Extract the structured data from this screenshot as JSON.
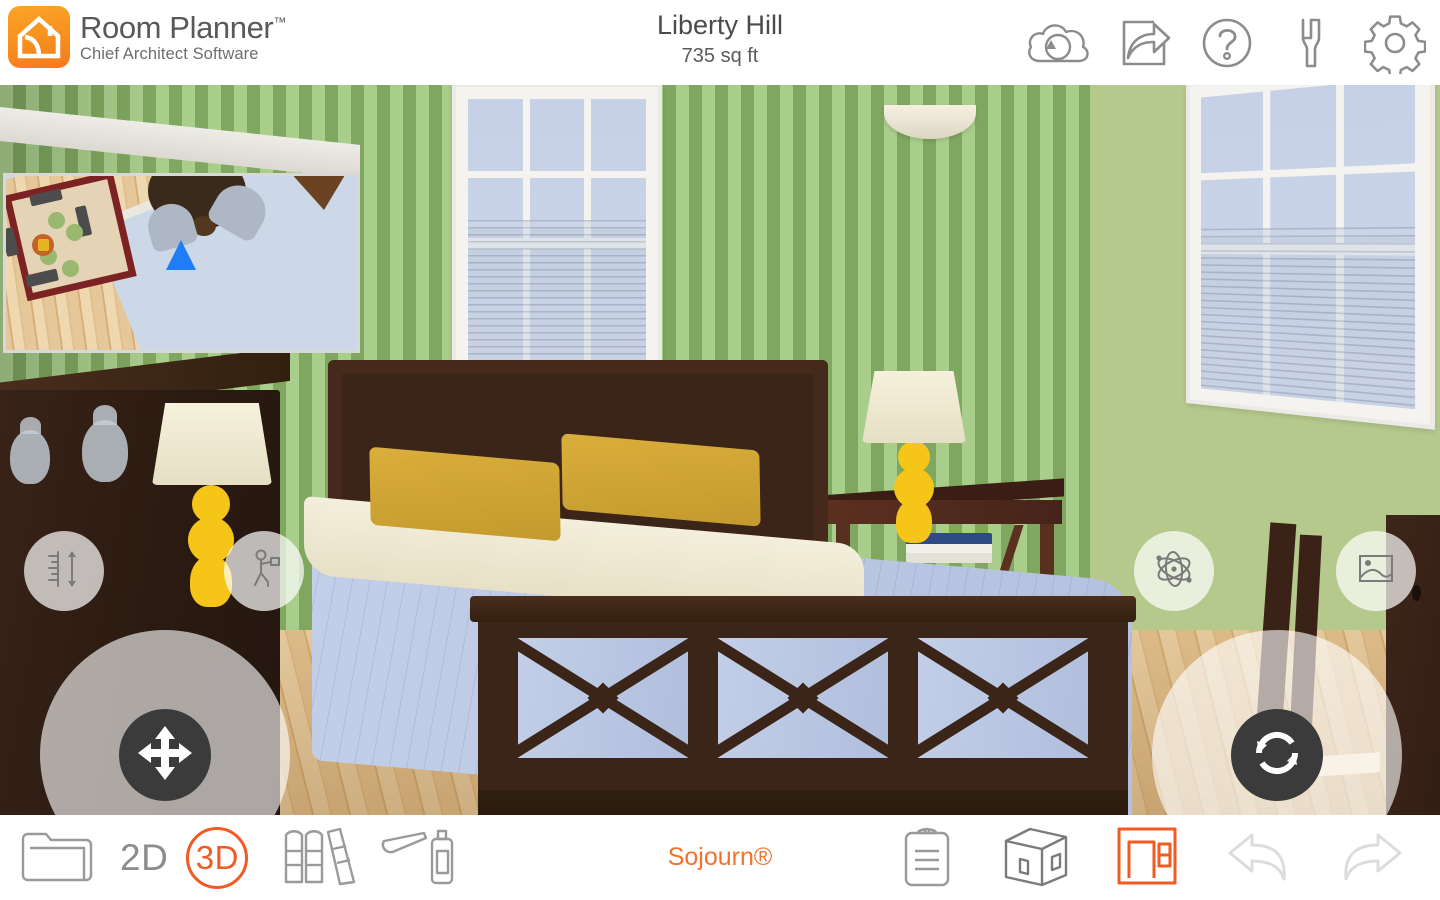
{
  "header": {
    "brand_name": "Room Planner",
    "brand_tm": "™",
    "brand_sub": "Chief Architect Software",
    "project_title": "Liberty Hill",
    "project_area": "735 sq ft",
    "actions": [
      {
        "name": "cloud-sync-icon",
        "label": "Cloud Sync"
      },
      {
        "name": "share-icon",
        "label": "Share"
      },
      {
        "name": "help-icon",
        "label": "Help"
      },
      {
        "name": "tools-icon",
        "label": "Tools"
      },
      {
        "name": "settings-icon",
        "label": "Settings"
      }
    ]
  },
  "viewport": {
    "mode": "3D",
    "minimap": {
      "label": "Floor plan overview",
      "camera_marker": "camera-position-arrow"
    },
    "controls": {
      "elevation": {
        "label": "Elevation / Height",
        "icon": "ruler-height-icon"
      },
      "walk": {
        "label": "Walkthrough",
        "icon": "walking-person-icon"
      },
      "orbit": {
        "label": "Orbit",
        "icon": "atom-orbit-icon"
      },
      "photo": {
        "label": "Render Photo",
        "icon": "photo-image-icon"
      },
      "pan_joystick": {
        "label": "Pan",
        "icon": "four-way-arrows-icon"
      },
      "rotate_joystick": {
        "label": "Rotate",
        "icon": "circular-arrows-icon"
      }
    }
  },
  "toolbar": {
    "folder_label": "Projects",
    "view_2d": "2D",
    "view_3d": "3D",
    "library_label": "Library",
    "materials_label": "Materials",
    "style_name": "Sojourn®",
    "notes_label": "Notes",
    "building_label": "Building",
    "room_plan_label": "Room Plan",
    "undo_label": "Undo",
    "redo_label": "Redo"
  },
  "colors": {
    "accent_orange": "#f15a22",
    "style_orange": "#f3722c",
    "logo_orange": "#f78f1e",
    "text_gray": "#58595b",
    "wall_stripe_light": "#a9cd8b",
    "wall_stripe_dark": "#7fa75f",
    "wall_plain": "#b6c98d",
    "floor_wood": "#e8c794",
    "bed_frame": "#3b2418",
    "pillow_gold": "#d9ae3c",
    "duvet_blue": "#c3cfe8",
    "lamp_yellow": "#f5c518",
    "disabled_gray": "#dcdcdc"
  }
}
